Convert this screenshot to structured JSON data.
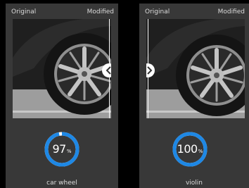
{
  "colors": {
    "accent": "#1e88e5",
    "track": "#ffffff",
    "panel_bg": "#383838",
    "page_bg": "#000000",
    "text": "#dcdcdc"
  },
  "cards": [
    {
      "header_left": "Original",
      "header_right": "Modified",
      "score_value": "97",
      "score_unit": "%",
      "score_fraction": 0.97,
      "prediction": "car wheel",
      "slider_icon": "chevron-left-icon"
    },
    {
      "header_left": "Original",
      "header_right": "Modified",
      "score_value": "100",
      "score_unit": "%",
      "score_fraction": 1.0,
      "prediction": "violin",
      "slider_icon": "chevron-right-icon"
    }
  ]
}
